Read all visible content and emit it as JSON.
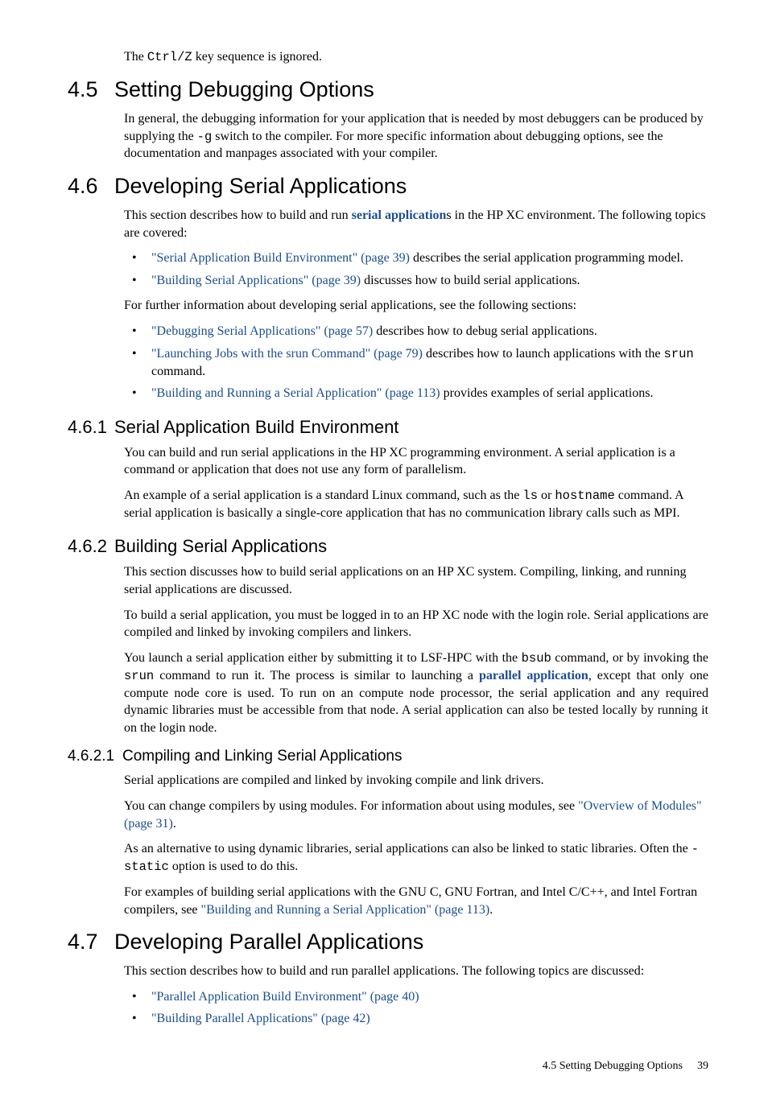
{
  "intro": {
    "p1_pre": "The ",
    "p1_code": "Ctrl/Z",
    "p1_post": " key sequence is ignored."
  },
  "s45": {
    "num": "4.5",
    "title": "Setting Debugging Options",
    "p1_a": "In general, the debugging information for your application that is needed by most debuggers can be produced by supplying the ",
    "p1_code": "-g",
    "p1_b": " switch to the compiler. For more specific information about debugging options, see the documentation and manpages associated with your compiler."
  },
  "s46": {
    "num": "4.6",
    "title": "Developing Serial Applications",
    "p1_a": "This section describes how to build and run ",
    "p1_bold": "serial application",
    "p1_b": "s in the HP XC environment. The following topics are covered:",
    "li1_link": "\"Serial Application Build Environment\" (page 39)",
    "li1_rest": " describes the serial application programming model.",
    "li2_link": "\"Building Serial Applications\" (page 39)",
    "li2_rest": " discusses how to build serial applications.",
    "p2": "For further information about developing serial applications, see the following sections:",
    "li3_link": "\"Debugging Serial Applications\" (page 57)",
    "li3_rest": " describes how to debug serial applications.",
    "li4_link": "\"Launching Jobs with the srun Command\" (page 79)",
    "li4_rest_a": " describes how to launch applications with the ",
    "li4_code": "srun",
    "li4_rest_b": " command.",
    "li5_link": "\"Building and Running a Serial Application\" (page 113)",
    "li5_rest": " provides examples of serial applications."
  },
  "s461": {
    "num": "4.6.1",
    "title": "Serial Application Build Environment",
    "p1": "You can build and run serial applications in the HP XC programming environment. A serial application is a command or application that does not use any form of parallelism.",
    "p2_a": "An example of a serial application is a standard Linux command, such as the ",
    "p2_code1": "ls",
    "p2_b": " or ",
    "p2_code2": "hostname",
    "p2_c": " command. A serial application is basically a single-core application that has no communication library calls such as MPI."
  },
  "s462": {
    "num": "4.6.2",
    "title": "Building Serial Applications",
    "p1": "This section discusses how to build serial applications on an HP XC system. Compiling, linking, and running serial applications are discussed.",
    "p2": "To build a serial application, you must be logged in to an HP XC node with the login role. Serial applications are compiled and linked by invoking compilers and linkers.",
    "p3_a": "You launch a serial application either by submitting it to LSF-HPC with the ",
    "p3_code1": "bsub",
    "p3_b": " command, or by invoking the ",
    "p3_code2": "srun",
    "p3_c": " command to run it. The process is similar to launching a ",
    "p3_bold": "parallel application",
    "p3_d": ", except that only one compute node core is used. To run on an compute node processor, the serial application and any required dynamic libraries must be accessible from that node. A serial application can also be tested locally by running it on the login node."
  },
  "s4621": {
    "num": "4.6.2.1",
    "title": "Compiling and Linking Serial Applications",
    "p1": "Serial applications are compiled and linked by invoking compile and link drivers.",
    "p2_a": "You can change compilers by using modules. For information about using modules, see ",
    "p2_link": "\"Overview of Modules\" (page 31)",
    "p2_b": ".",
    "p3_a": "As an alternative to using dynamic libraries, serial applications can also be linked to static libraries. Often the ",
    "p3_code": "-static",
    "p3_b": " option is used to do this.",
    "p4_a": "For examples of building serial applications with the GNU C, GNU Fortran, and Intel C/C++, and Intel Fortran compilers, see ",
    "p4_link": "\"Building and Running a Serial Application\" (page 113)",
    "p4_b": "."
  },
  "s47": {
    "num": "4.7",
    "title": "Developing Parallel Applications",
    "p1": "This section describes how to build and run parallel applications. The following topics are discussed:",
    "li1_link": "\"Parallel Application Build Environment\" (page 40)",
    "li2_link": "\"Building Parallel Applications\" (page 42)"
  },
  "footer": {
    "text": "4.5   Setting Debugging Options",
    "page": "39"
  }
}
